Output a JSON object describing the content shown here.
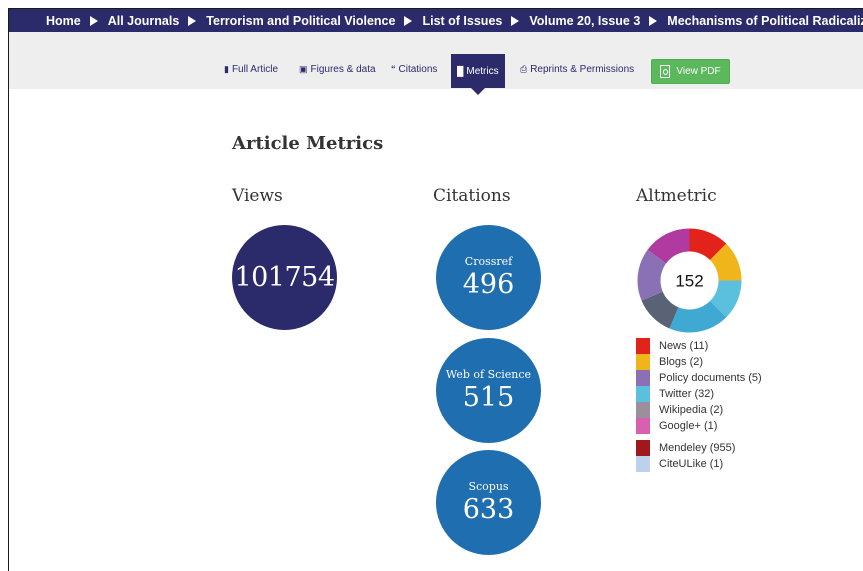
{
  "breadcrumb": {
    "items": [
      "Home",
      "All Journals",
      "Terrorism and Political Violence",
      "List of Issues",
      "Volume 20, Issue 3"
    ],
    "current": "Mechanisms of Political Radicalization: ...."
  },
  "tabs": {
    "full_article": "Full Article",
    "figures": "Figures & data",
    "citations": "Citations",
    "metrics": "Metrics",
    "reprints": "Reprints & Permissions",
    "view_pdf": "View PDF"
  },
  "page": {
    "title": "Article Metrics",
    "views_heading": "Views",
    "citations_heading": "Citations",
    "altmetric_heading": "Altmetric"
  },
  "views": {
    "count": "101754"
  },
  "citations": [
    {
      "label": "Crossref",
      "count": "496"
    },
    {
      "label": "Web of Science",
      "count": "515"
    },
    {
      "label": "Scopus",
      "count": "633"
    }
  ],
  "altmetric": {
    "score": "152",
    "sources": [
      {
        "label": "News (11)",
        "color": "#e2231a"
      },
      {
        "label": "Blogs (2)",
        "color": "#f1b51c"
      },
      {
        "label": "Policy documents (5)",
        "color": "#8a71b5"
      },
      {
        "label": "Twitter (32)",
        "color": "#5bc0de"
      },
      {
        "label": "Wikipedia (2)",
        "color": "#9b8f9c"
      },
      {
        "label": "Google+ (1)",
        "color": "#d760b1"
      }
    ],
    "readers": [
      {
        "label": "Mendeley (955)",
        "color": "#a0181c"
      },
      {
        "label": "CiteULike (1)",
        "color": "#bcd2ec"
      }
    ]
  }
}
